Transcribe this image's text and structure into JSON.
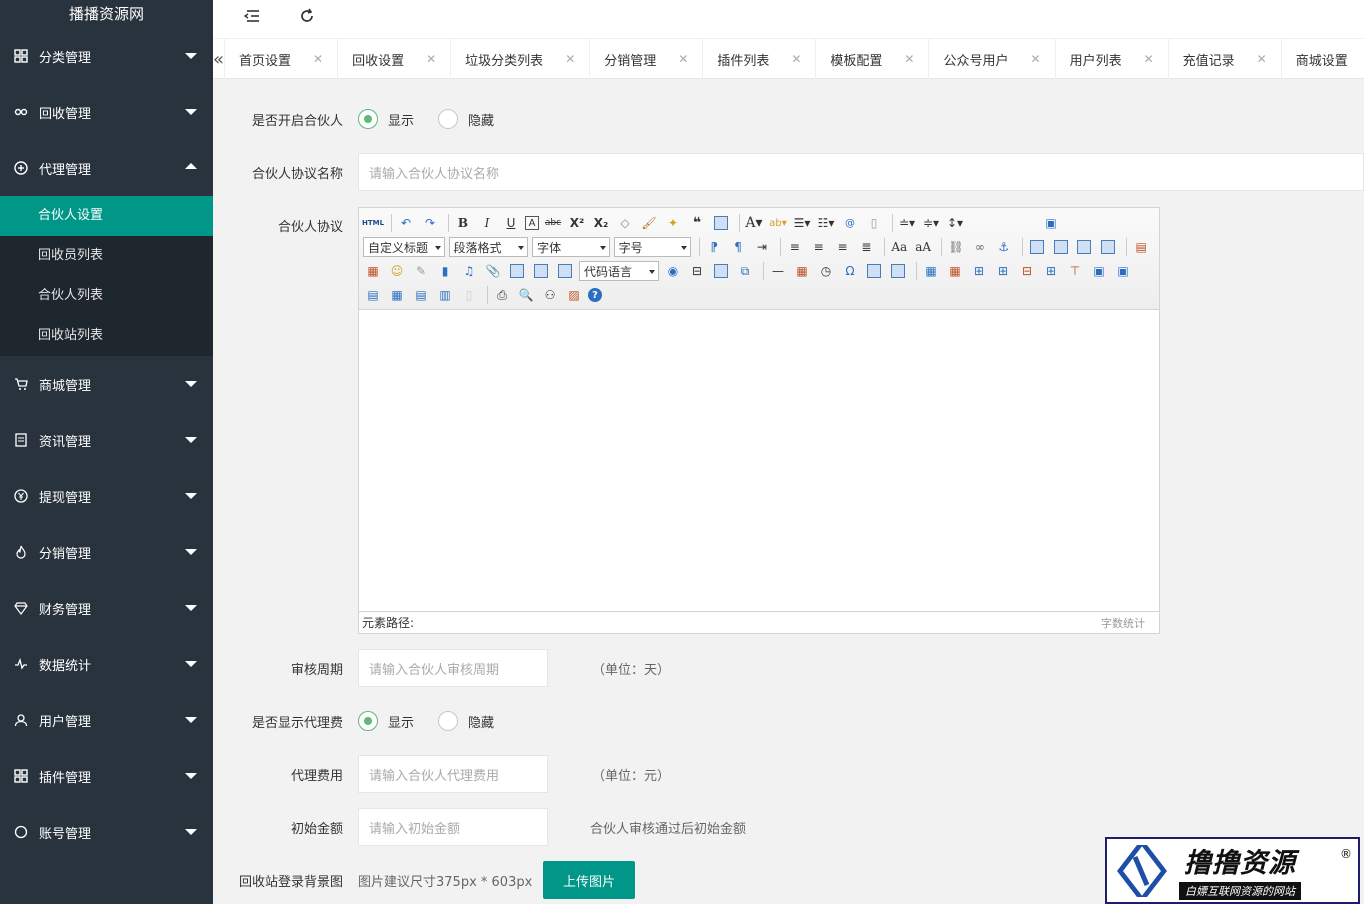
{
  "sidebar": {
    "logo": "播播资源网",
    "items": [
      {
        "label": "分类管理",
        "icon": "grid-icon"
      },
      {
        "label": "回收管理",
        "icon": "link-icon"
      },
      {
        "label": "代理管理",
        "icon": "plus-circle-icon",
        "expanded": true
      },
      {
        "label": "商城管理",
        "icon": "cart-icon"
      },
      {
        "label": "资讯管理",
        "icon": "news-icon"
      },
      {
        "label": "提现管理",
        "icon": "yen-circle-icon"
      },
      {
        "label": "分销管理",
        "icon": "fire-icon"
      },
      {
        "label": "财务管理",
        "icon": "diamond-icon"
      },
      {
        "label": "数据统计",
        "icon": "pulse-icon"
      },
      {
        "label": "用户管理",
        "icon": "user-icon"
      },
      {
        "label": "插件管理",
        "icon": "grid-icon"
      },
      {
        "label": "账号管理",
        "icon": "circle-icon"
      }
    ],
    "subitems": [
      "合伙人设置",
      "回收员列表",
      "合伙人列表",
      "回收站列表"
    ],
    "active_subitem": "合伙人设置"
  },
  "tabs": [
    "首页设置",
    "回收设置",
    "垃圾分类列表",
    "分销管理",
    "插件列表",
    "模板配置",
    "公众号用户",
    "用户列表",
    "充值记录",
    "商城设置"
  ],
  "form": {
    "open_partner": {
      "label": "是否开启合伙人",
      "options": [
        "显示",
        "隐藏"
      ],
      "selected": "显示"
    },
    "agreement_name": {
      "label": "合伙人协议名称",
      "placeholder": "请输入合伙人协议名称"
    },
    "agreement": {
      "label": "合伙人协议"
    },
    "review_period": {
      "label": "审核周期",
      "placeholder": "请输入合伙人审核周期",
      "unit": "（单位：天）"
    },
    "show_fee": {
      "label": "是否显示代理费",
      "options": [
        "显示",
        "隐藏"
      ],
      "selected": "显示"
    },
    "agent_fee": {
      "label": "代理费用",
      "placeholder": "请输入合伙人代理费用",
      "unit": "（单位：元）"
    },
    "initial_amount": {
      "label": "初始金额",
      "placeholder": "请输入初始金额",
      "hint": "合伙人审核通过后初始金额"
    },
    "background": {
      "label": "回收站登录背景图",
      "hint": "图片建议尺寸375px * 603px",
      "button": "上传图片"
    }
  },
  "editor": {
    "selects": [
      "自定义标题",
      "段落格式",
      "字体",
      "字号",
      "代码语言"
    ],
    "html_label": "HTML",
    "path_label": "元素路径:",
    "count_label": "字数统计"
  },
  "watermark": {
    "title": "撸撸资源",
    "subtitle": "白嫖互联网资源的网站",
    "mark": "®"
  }
}
